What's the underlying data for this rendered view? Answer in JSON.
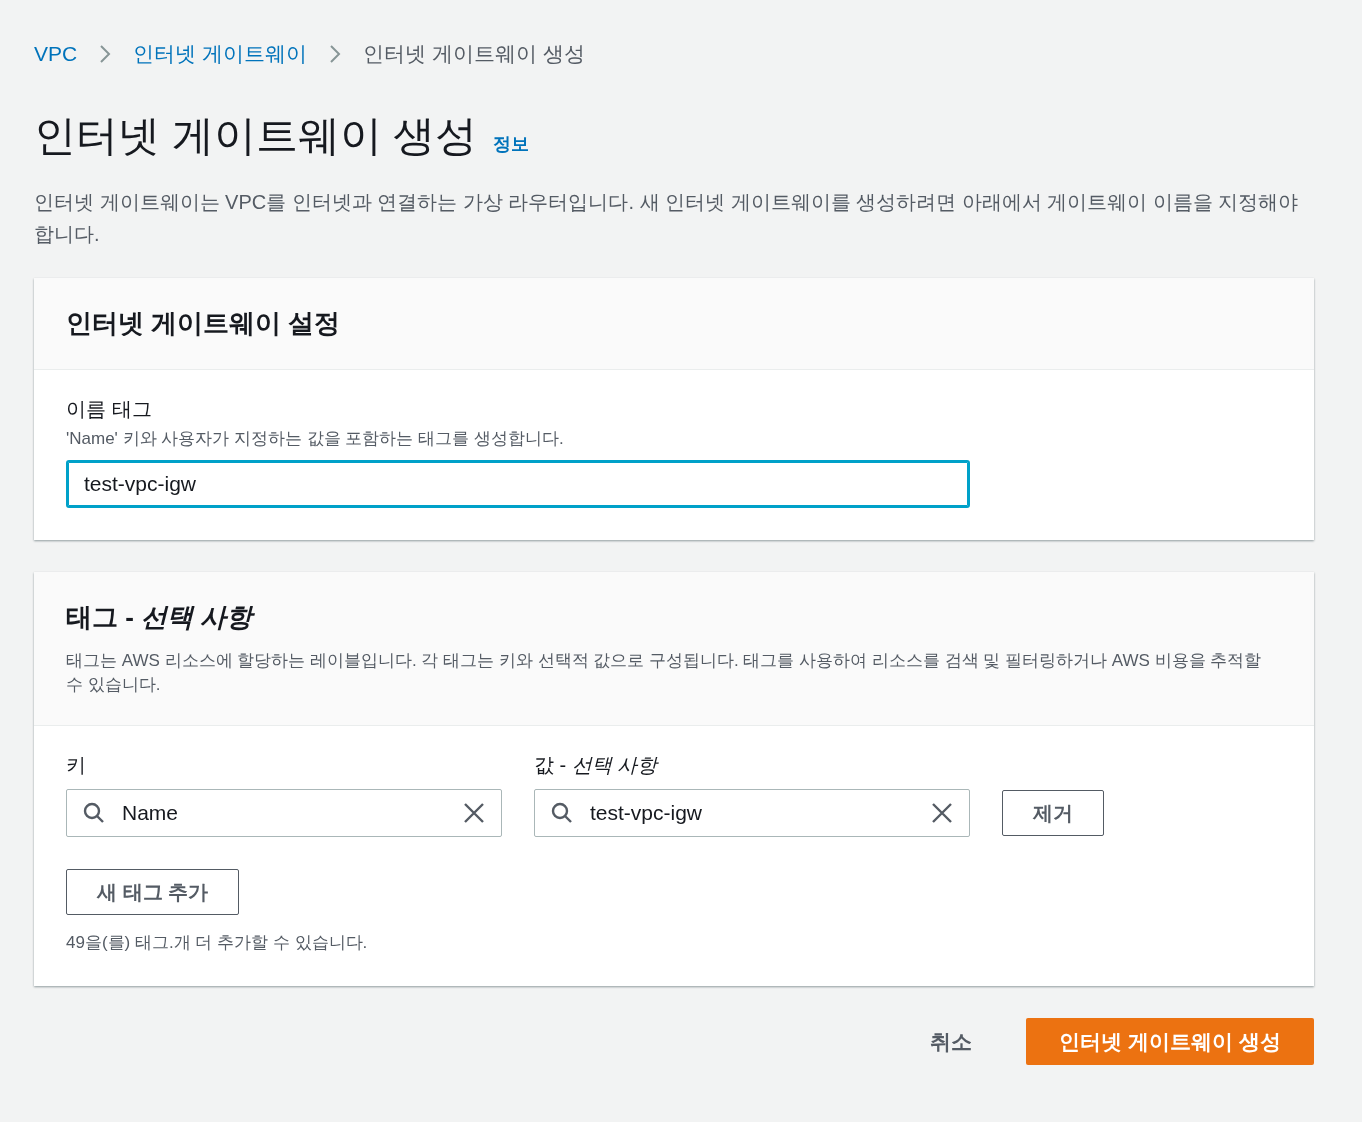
{
  "breadcrumb": [
    {
      "label": "VPC",
      "link": true
    },
    {
      "label": "인터넷 게이트웨이",
      "link": true
    },
    {
      "label": "인터넷 게이트웨이 생성",
      "link": false
    }
  ],
  "page": {
    "title": "인터넷 게이트웨이 생성",
    "info_link": "정보",
    "description": "인터넷 게이트웨이는 VPC를 인터넷과 연결하는 가상 라우터입니다. 새 인터넷 게이트웨이를 생성하려면 아래에서 게이트웨이 이름을 지정해야 합니다."
  },
  "settings_card": {
    "title": "인터넷 게이트웨이 설정",
    "field": {
      "label": "이름 태그",
      "hint": "'Name' 키와 사용자가 지정하는 값을 포함하는 태그를 생성합니다.",
      "value": "test-vpc-igw",
      "focused": true
    }
  },
  "tags_card": {
    "title": "태그 - *선택 사항*",
    "description": "태그는 AWS 리소스에 할당하는 레이블입니다. 각 태그는 키와 선택적 값으로 구성됩니다. 태그를 사용하여 리소스를 검색 및 필터링하거나 AWS 비용을 추적할 수 있습니다.",
    "key_label": "키",
    "value_label": "값 - *선택 사항*",
    "tags": [
      {
        "key": "Name",
        "value": "test-vpc-igw",
        "remove": "제거"
      }
    ],
    "add_button": "새 태그 추가",
    "remaining": "49을(를) 태그.개 더 추가할 수 있습니다."
  },
  "actions": {
    "cancel": "취소",
    "submit": "인터넷 게이트웨이 생성"
  }
}
